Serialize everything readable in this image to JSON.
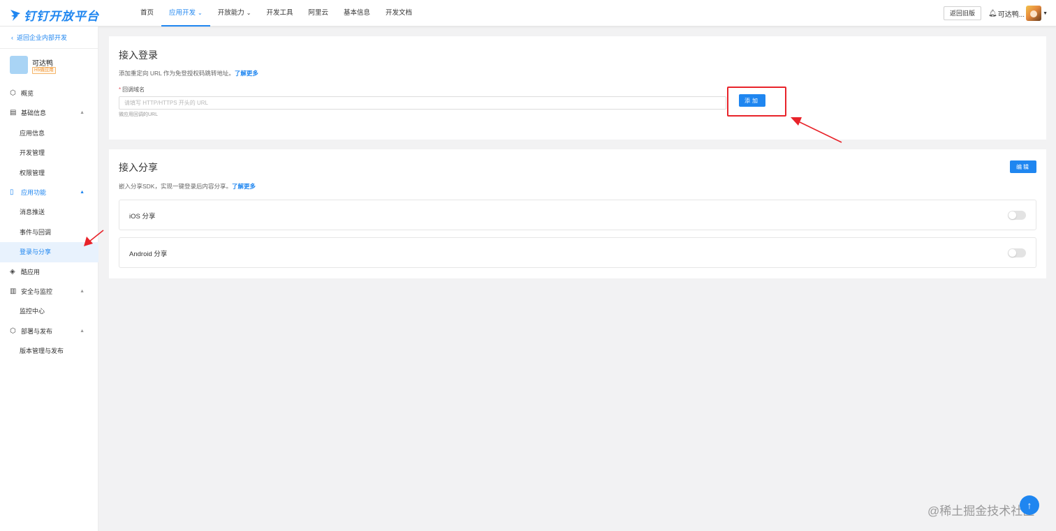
{
  "header": {
    "logo_text": "钉钉开放平台",
    "nav": [
      {
        "label": "首页"
      },
      {
        "label": "应用开发",
        "active": true
      },
      {
        "label": "开放能力"
      },
      {
        "label": "开发工具"
      },
      {
        "label": "阿里云"
      },
      {
        "label": "基本信息"
      },
      {
        "label": "开发文档"
      }
    ],
    "old_version_button": "返回旧版",
    "user_name": "可达鸭..."
  },
  "sidebar": {
    "back_link": "返回企业内部开发",
    "app_name": "可达鸭",
    "app_tag": "H5微应用",
    "items": [
      {
        "label": "概览",
        "icon": "cube-icon"
      },
      {
        "label": "基础信息",
        "icon": "document-icon"
      },
      {
        "label": "应用信息"
      },
      {
        "label": "开发管理"
      },
      {
        "label": "权限管理"
      },
      {
        "label": "应用功能",
        "icon": "app-feature-icon"
      },
      {
        "label": "消息推送"
      },
      {
        "label": "事件与回调"
      },
      {
        "label": "登录与分享"
      },
      {
        "label": "酷应用",
        "icon": "cool-app-icon"
      },
      {
        "label": "安全与监控",
        "icon": "bar-chart-icon"
      },
      {
        "label": "监控中心"
      },
      {
        "label": "部署与发布",
        "icon": "package-icon"
      },
      {
        "label": "版本管理与发布"
      }
    ]
  },
  "login": {
    "title": "接入登录",
    "desc": "添加重定向 URL 作为免登授权码跳转地址。",
    "learn_more": "了解更多",
    "field_label": "回调域名",
    "input_placeholder": "请填写 HTTP/HTTPS 开头的 URL",
    "field_hint": "微应用回调的URL",
    "add_button": "添加"
  },
  "share": {
    "title": "接入分享",
    "desc": "嵌入分享SDK，实现一键登录后内容分享。",
    "learn_more": "了解更多",
    "edit_button": "编辑",
    "rows": [
      {
        "label": "iOS 分享",
        "enabled": false
      },
      {
        "label": "Android 分享",
        "enabled": false
      }
    ]
  },
  "watermark": "@稀土掘金技术社区",
  "colors": {
    "accent": "#1f86f0",
    "highlight": "#e8232a"
  }
}
